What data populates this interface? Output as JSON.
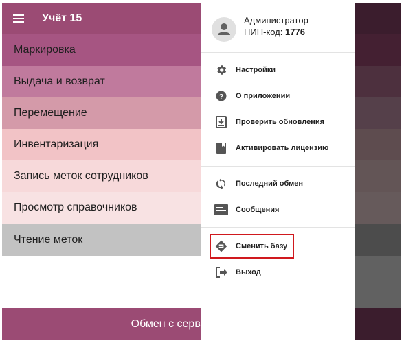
{
  "app": {
    "title": "Учёт 15",
    "menu": [
      {
        "label": "Маркировка",
        "color": "#a65582"
      },
      {
        "label": "Выдача и возврат",
        "color": "#c07a9d"
      },
      {
        "label": "Перемещение",
        "color": "#d49aa9"
      },
      {
        "label": "Инвентаризация",
        "color": "#f2c3c6"
      },
      {
        "label": "Запись меток сотрудников",
        "color": "#f7d9da"
      },
      {
        "label": "Просмотр справочников",
        "color": "#f8e2e3"
      },
      {
        "label": "Чтение меток",
        "color": "#c2c2c2"
      }
    ],
    "sync_button": "Обмен с сервером"
  },
  "drawer": {
    "user_name": "Администратор",
    "pin_label": "ПИН-код: ",
    "pin_value": "1776",
    "items": [
      {
        "label": "Настройки",
        "icon": "gear-icon"
      },
      {
        "label": "О приложении",
        "icon": "help-icon"
      },
      {
        "label": "Проверить обновления",
        "icon": "download-icon"
      },
      {
        "label": "Активировать лицензию",
        "icon": "license-icon"
      },
      {
        "label": "Последний обмен",
        "icon": "sync-icon"
      },
      {
        "label": "Сообщения",
        "icon": "message-icon"
      },
      {
        "label": "Сменить базу",
        "icon": "database-switch-icon"
      },
      {
        "label": "Выход",
        "icon": "logout-icon"
      }
    ]
  },
  "colors": {
    "primary": "#9b4b74",
    "highlight_border": "#d0191e"
  }
}
